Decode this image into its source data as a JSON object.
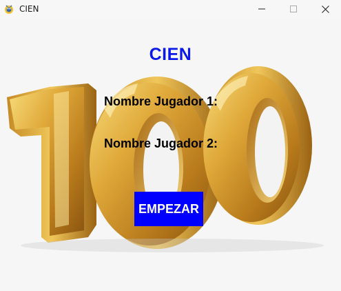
{
  "window": {
    "title": "CIEN",
    "icon": "pygame-snake-icon",
    "controls": [
      "minimize-icon",
      "maximize-icon",
      "close-icon"
    ]
  },
  "game": {
    "title": "CIEN",
    "title_color": "#0b18e8",
    "background_image": "golden-100-numerals-image",
    "player1_label": "Nombre Jugador 1:",
    "player2_label": "Nombre Jugador 2:",
    "start_label": "EMPEZAR",
    "start_color": "#0000ff"
  }
}
